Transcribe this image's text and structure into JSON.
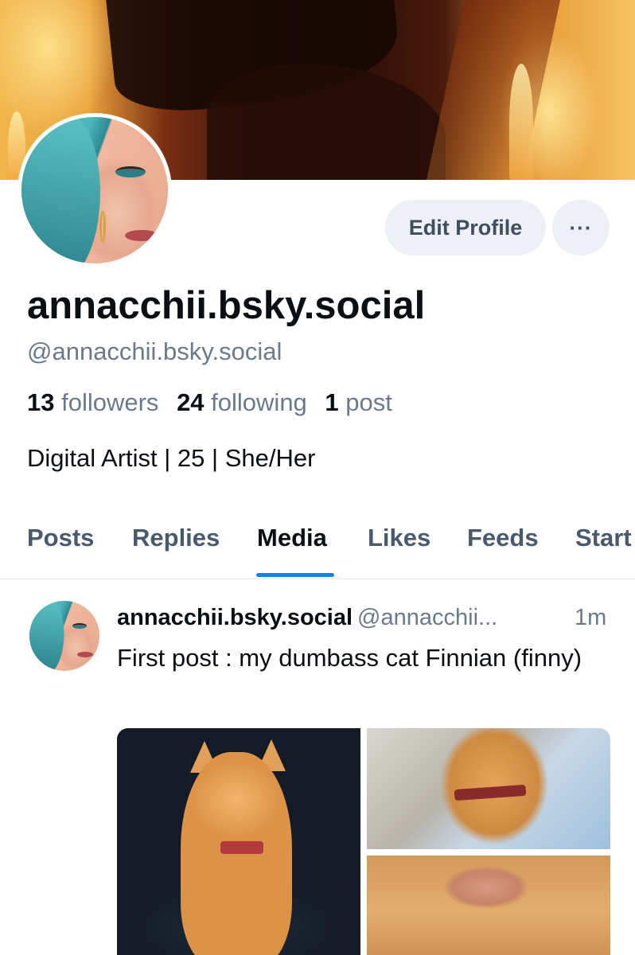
{
  "profile": {
    "display_name": "annacchii.bsky.social",
    "handle": "@annacchii.bsky.social",
    "followers_count": "13",
    "followers_label": "followers",
    "following_count": "24",
    "following_label": "following",
    "posts_count": "1",
    "posts_label": "post",
    "bio": "Digital Artist | 25 | She/Her"
  },
  "actions": {
    "edit_label": "Edit Profile",
    "more_label": "···"
  },
  "tabs": [
    {
      "label": "Posts"
    },
    {
      "label": "Replies"
    },
    {
      "label": "Media",
      "active": true
    },
    {
      "label": "Likes"
    },
    {
      "label": "Feeds"
    },
    {
      "label": "Start"
    }
  ],
  "post": {
    "author_name": "annacchii.bsky.social",
    "author_handle": "@annacchii...",
    "time": "1m",
    "text": "First post : my dumbass cat Finnian (finny)"
  },
  "colors": {
    "accent": "#1083fe",
    "text_primary": "#0b0f14",
    "text_secondary": "#6b7a8b",
    "button_bg": "#edf1f5"
  }
}
